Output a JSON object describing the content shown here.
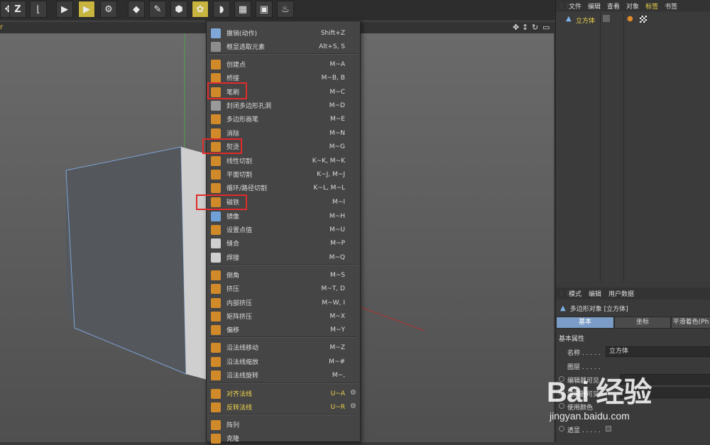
{
  "toolbar": {
    "icons": [
      "z-icon",
      "undo-icon",
      "play-icon",
      "render-icon",
      "render-settings-icon",
      "cube-icon",
      "pen-icon",
      "subdivision-icon",
      "cloner-icon",
      "deformer-icon",
      "floor-icon",
      "camera-icon",
      "light-icon"
    ],
    "z_glyph": "Z"
  },
  "viewport": {
    "header_label": "r"
  },
  "menu": {
    "items": [
      {
        "label": "撤销(动作)",
        "shortcut": "Shift+Z",
        "color": "#7fa7d8"
      },
      {
        "label": "框显选取元素",
        "shortcut": "Alt+S, S",
        "color": "#8d8d8d"
      },
      {
        "label": "创建点",
        "shortcut": "M~A",
        "color": "#d08a2a"
      },
      {
        "label": "桥接",
        "shortcut": "M~B, B",
        "color": "#d08a2a"
      },
      {
        "label": "笔刷",
        "shortcut": "M~C",
        "color": "#d08a2a"
      },
      {
        "label": "封闭多边形孔洞",
        "shortcut": "M~D",
        "color": "#9a9a9a"
      },
      {
        "label": "多边形画笔",
        "shortcut": "M~E",
        "color": "#d08a2a"
      },
      {
        "label": "消除",
        "shortcut": "M~N",
        "color": "#d08a2a"
      },
      {
        "label": "熨烫",
        "shortcut": "M~G",
        "color": "#d08a2a"
      },
      {
        "label": "线性切割",
        "shortcut": "K~K, M~K",
        "color": "#d08a2a"
      },
      {
        "label": "平面切割",
        "shortcut": "K~J, M~J",
        "color": "#d08a2a"
      },
      {
        "label": "循环/路径切割",
        "shortcut": "K~L, M~L",
        "color": "#d08a2a"
      },
      {
        "label": "磁铁",
        "shortcut": "M~I",
        "color": "#d08a2a"
      },
      {
        "label": "镜像",
        "shortcut": "M~H",
        "color": "#6fa0d8"
      },
      {
        "label": "设置点值",
        "shortcut": "M~U",
        "color": "#d08a2a"
      },
      {
        "label": "缝合",
        "shortcut": "M~P",
        "color": "#cfcfcf"
      },
      {
        "label": "焊接",
        "shortcut": "M~Q",
        "color": "#cfcfcf"
      },
      {
        "label": "倒角",
        "shortcut": "M~S",
        "color": "#d08a2a"
      },
      {
        "label": "挤压",
        "shortcut": "M~T, D",
        "color": "#d08a2a"
      },
      {
        "label": "内部挤压",
        "shortcut": "M~W, I",
        "color": "#d08a2a"
      },
      {
        "label": "矩阵挤压",
        "shortcut": "M~X",
        "color": "#d08a2a"
      },
      {
        "label": "偏移",
        "shortcut": "M~Y",
        "color": "#d08a2a"
      },
      {
        "label": "沿法线移动",
        "shortcut": "M~Z",
        "color": "#d08a2a"
      },
      {
        "label": "沿法线缩放",
        "shortcut": "M~#",
        "color": "#d08a2a"
      },
      {
        "label": "沿法线旋转",
        "shortcut": "M~,",
        "color": "#d08a2a"
      },
      {
        "label": "对齐法线",
        "shortcut": "U~A",
        "color": "#d08a2a",
        "yellow": true,
        "gear": true
      },
      {
        "label": "反转法线",
        "shortcut": "U~R",
        "color": "#d08a2a",
        "yellow": true,
        "gear": true
      },
      {
        "label": "阵列",
        "shortcut": "",
        "color": "#d08a2a"
      },
      {
        "label": "克隆",
        "shortcut": "",
        "color": "#d08a2a"
      }
    ]
  },
  "object_manager": {
    "menu": [
      "文件",
      "编辑",
      "查看",
      "对象",
      "标签",
      "书签"
    ],
    "active_menu": "标签",
    "object_name": "立方体"
  },
  "attribute_manager": {
    "menu": [
      "模式",
      "编辑",
      "用户数据"
    ],
    "title": "多边形对象 [立方体]",
    "tabs": [
      "基本",
      "坐标",
      "平滑着色(Ph"
    ],
    "section": "基本属性",
    "fields": [
      {
        "key": "名称 . . . . .",
        "value": "立方体"
      },
      {
        "key": "图层 . . . . .",
        "value": ""
      },
      {
        "key": "编辑器可见",
        "value": ""
      },
      {
        "key": "渲染器可见",
        "value": ""
      },
      {
        "key": "使用颜色",
        "value": ""
      },
      {
        "key": "透显 . . . . .",
        "value": ""
      }
    ]
  },
  "watermark": {
    "line1": "Bai 经验",
    "line2": "jingyan.baidu.com"
  }
}
